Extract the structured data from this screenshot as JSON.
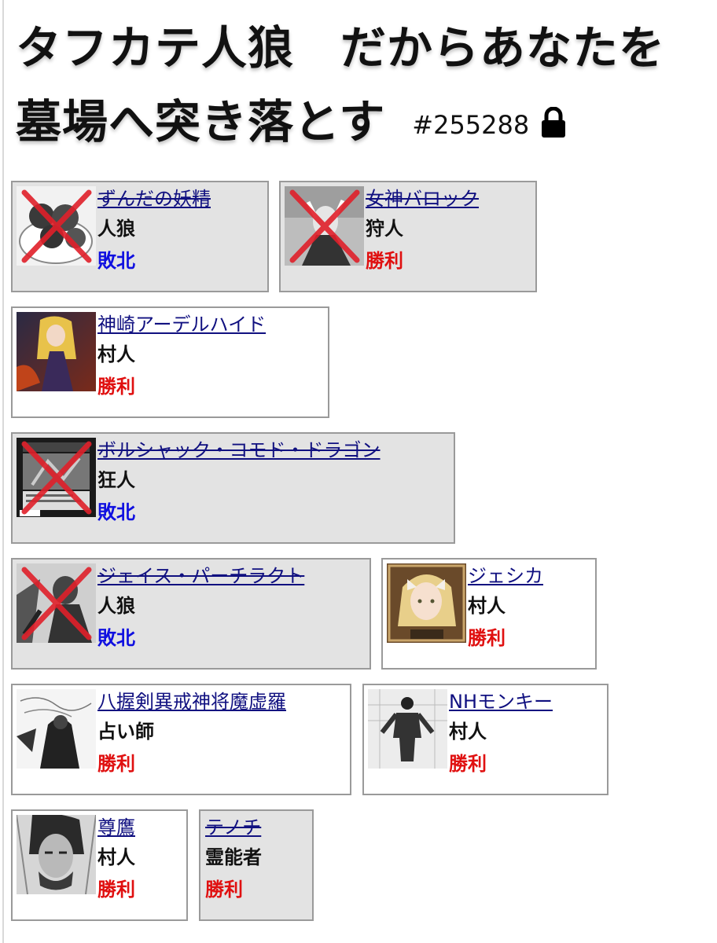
{
  "title": {
    "line1": "タフカテ人狼　だからあなたを",
    "line2": "墓場へ突き落とす",
    "game_id": "#255288"
  },
  "colors": {
    "win": "#e01010",
    "lose": "#1010e0",
    "name_link": "#101080",
    "dead_bg": "#e3e3e3"
  },
  "players": [
    {
      "name": "ずんだの妖精",
      "role": "人狼",
      "result": "敗北",
      "dead": true,
      "icon": "fairy-dumplings-avatar"
    },
    {
      "name": "女神バロック",
      "role": "狩人",
      "result": "勝利",
      "dead": true,
      "icon": "goddess-portrait-avatar"
    },
    {
      "name": "神崎アーデルハイド",
      "role": "村人",
      "result": "勝利",
      "dead": false,
      "icon": "anime-girl-avatar"
    },
    {
      "name": "ボルシャック・コモド・ドラゴン",
      "role": "狂人",
      "result": "敗北",
      "dead": true,
      "icon": "trading-card-avatar"
    },
    {
      "name": "ジェイス・パーチラクト",
      "role": "人狼",
      "result": "敗北",
      "dead": true,
      "icon": "monochrome-hero-avatar"
    },
    {
      "name": "ジェシカ",
      "role": "村人",
      "result": "勝利",
      "dead": false,
      "icon": "blonde-girl-avatar"
    },
    {
      "name": "八握剣異戒神将魔虚羅",
      "role": "占い師",
      "result": "勝利",
      "dead": false,
      "icon": "manga-sketch-avatar"
    },
    {
      "name": "NHモンキー",
      "role": "村人",
      "result": "勝利",
      "dead": false,
      "icon": "manga-fighter-avatar"
    },
    {
      "name": "尊鷹",
      "role": "村人",
      "result": "勝利",
      "dead": false,
      "icon": "manga-face-avatar"
    },
    {
      "name": "テノチ",
      "role": "霊能者",
      "result": "勝利",
      "dead": true,
      "icon": ""
    }
  ]
}
